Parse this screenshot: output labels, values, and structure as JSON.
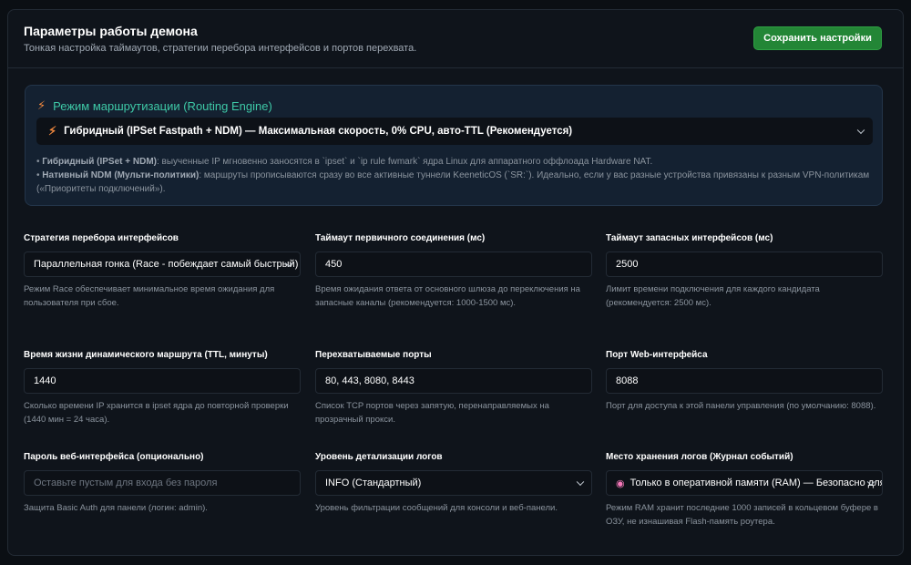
{
  "header": {
    "title": "Параметры работы демона",
    "subtitle": "Тонкая настройка таймаутов, стратегии перебора интерфейсов и портов перехвата.",
    "save_label": "Сохранить настройки"
  },
  "routing": {
    "title": "Режим маршрутизации (Routing Engine)",
    "selected": "Гибридный (IPSet Fastpath + NDM) — Максимальная скорость, 0% CPU, авто-TTL (Рекомендуется)",
    "desc1_bold": "Гибридный (IPSet + NDM)",
    "desc1_text": ": выученные IP мгновенно заносятся в `ipset` и `ip rule fwmark` ядра Linux для аппаратного оффлоада Hardware NAT.",
    "desc2_bold": "Нативный NDM (Мульти-политики)",
    "desc2_text": ": маршруты прописываются сразу во все активные туннели KeeneticOS (`SR:`). Идеально, если у вас разные устройства привязаны к разным VPN-политикам («Приоритеты подключений»)."
  },
  "fields": {
    "strategy": {
      "label": "Стратегия перебора интерфейсов",
      "value": "Параллельная гонка (Race - побеждает самый быстрый)",
      "help": "Режим Race обеспечивает минимальное время ожидания для пользователя при сбое."
    },
    "primary_timeout": {
      "label": "Таймаут первичного соединения (мс)",
      "value": "450",
      "help": "Время ожидания ответа от основного шлюза до переключения на запасные каналы (рекомендуется: 1000-1500 мс)."
    },
    "backup_timeout": {
      "label": "Таймаут запасных интерфейсов (мс)",
      "value": "2500",
      "help": "Лимит времени подключения для каждого кандидата (рекомендуется: 2500 мс)."
    },
    "ttl": {
      "label": "Время жизни динамического маршрута (TTL, минуты)",
      "value": "1440",
      "help": "Сколько времени IP хранится в ipset ядра до повторной проверки (1440 мин = 24 часа)."
    },
    "ports": {
      "label": "Перехватываемые порты",
      "value": "80, 443, 8080, 8443",
      "help": "Список TCP портов через запятую, перенаправляемых на прозрачный прокси."
    },
    "web_port": {
      "label": "Порт Web-интерфейса",
      "value": "8088",
      "help": "Порт для доступа к этой панели управления (по умолчанию: 8088)."
    },
    "password": {
      "label": "Пароль веб-интерфейса (опционально)",
      "placeholder": "Оставьте пустым для входа без пароля",
      "help": "Защита Basic Auth для панели (логин: admin)."
    },
    "log_level": {
      "label": "Уровень детализации логов",
      "value": "INFO (Стандартный)",
      "help": "Уровень фильтрации сообщений для консоли и веб-панели."
    },
    "log_storage": {
      "label": "Место хранения логов (Журнал событий)",
      "value": "Только в оперативной памяти (RAM) — Безопасно для Flash",
      "help": "Режим RAM хранит последние 1000 записей в кольцевом буфере в ОЗУ, не изнашивая Flash-память роутера."
    }
  },
  "icons": {
    "bolt": "lightning-icon",
    "brain": "brain-icon",
    "chevron": "chevron-down-icon"
  },
  "colors": {
    "accent_green": "#238636",
    "routing_title": "#3ec9a7",
    "bolt": "#f0883e",
    "background": "#0b0f14",
    "panel": "#0f141b"
  }
}
